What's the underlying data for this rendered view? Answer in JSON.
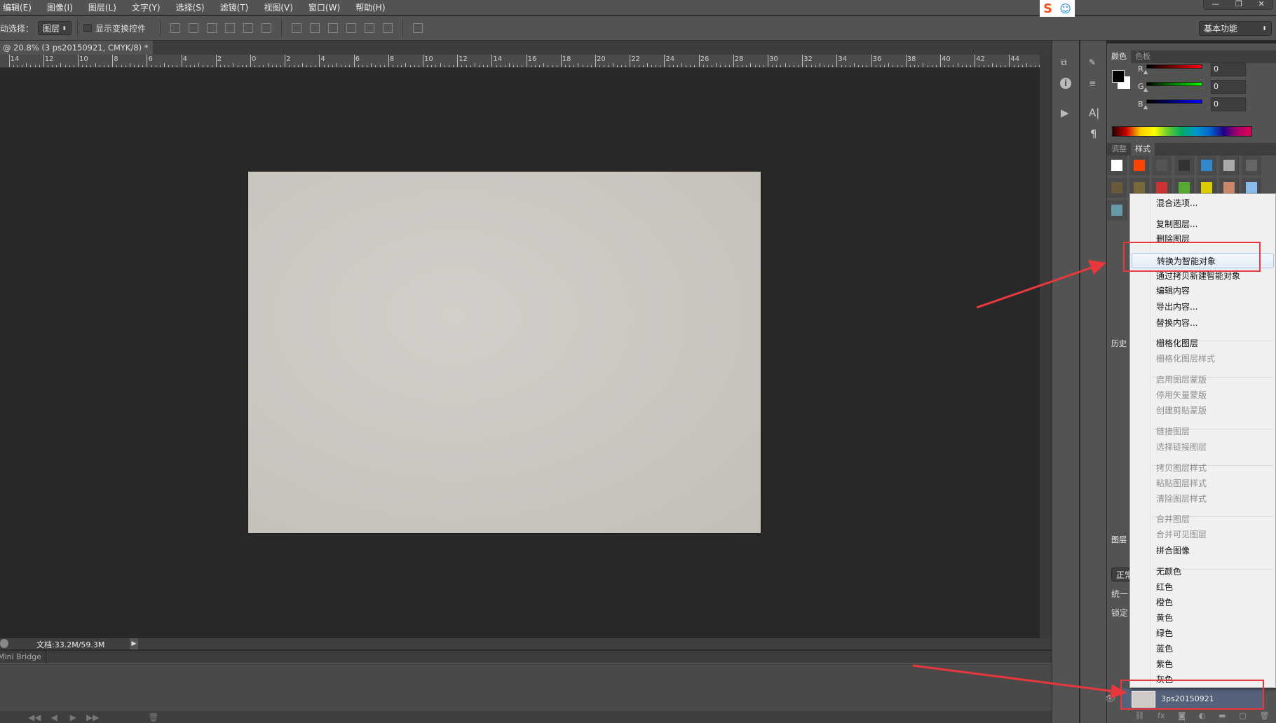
{
  "menu": [
    "编辑(E)",
    "图像(I)",
    "图层(L)",
    "文字(Y)",
    "选择(S)",
    "滤镜(T)",
    "视图(V)",
    "窗口(W)",
    "帮助(H)"
  ],
  "options": {
    "auto_select_label": "动选择：",
    "auto_select_value": "图层",
    "show_transform": "显示变换控件",
    "workspace": "基本功能"
  },
  "document_tab": {
    "title": "@ 20.8% (3 ps20150921, CMYK/8) *",
    "close": "×"
  },
  "ruler_labels": [
    "14",
    "12",
    "10",
    "8",
    "6",
    "4",
    "2",
    "0",
    "2",
    "4",
    "6",
    "8",
    "10",
    "12",
    "14",
    "16",
    "18",
    "20",
    "22",
    "24",
    "26",
    "28",
    "30",
    "32",
    "34",
    "36",
    "38",
    "40",
    "42",
    "44"
  ],
  "status": {
    "doc_size": "文档:33.2M/59.3M"
  },
  "mini_bridge": {
    "tab": "Mini Bridge"
  },
  "color_panel": {
    "tabs": [
      "颜色",
      "色板"
    ],
    "channels": [
      {
        "label": "R",
        "value": "0",
        "color": "#ff0000"
      },
      {
        "label": "G",
        "value": "0",
        "color": "#00ff00"
      },
      {
        "label": "B",
        "value": "0",
        "color": "#0000ff"
      }
    ]
  },
  "styles_panel": {
    "tabs": [
      "调整",
      "样式"
    ]
  },
  "history_panel": {
    "tab": "历史"
  },
  "layers_panel": {
    "tab": "图层",
    "blend": "正常",
    "unify": "统一",
    "lock": "锁定",
    "layer_name": "3ps20150921"
  },
  "context_menu": {
    "items": [
      {
        "label": "混合选项...",
        "enabled": true
      },
      {
        "label": "复制图层...",
        "enabled": true
      },
      {
        "label": "删除图层",
        "enabled": true
      },
      {
        "label": "转换为智能对象",
        "enabled": true,
        "highlighted": true
      },
      {
        "label": "通过拷贝新建智能对象",
        "enabled": true
      },
      {
        "label": "编辑内容",
        "enabled": true
      },
      {
        "label": "导出内容...",
        "enabled": true
      },
      {
        "label": "替换内容...",
        "enabled": true
      },
      {
        "label": "栅格化图层",
        "enabled": true
      },
      {
        "label": "栅格化图层样式",
        "enabled": false
      },
      {
        "label": "启用图层蒙版",
        "enabled": false
      },
      {
        "label": "停用矢量蒙版",
        "enabled": false
      },
      {
        "label": "创建剪贴蒙版",
        "enabled": false
      },
      {
        "label": "链接图层",
        "enabled": false
      },
      {
        "label": "选择链接图层",
        "enabled": false
      },
      {
        "label": "拷贝图层样式",
        "enabled": false
      },
      {
        "label": "粘贴图层样式",
        "enabled": false
      },
      {
        "label": "清除图层样式",
        "enabled": false
      },
      {
        "label": "合并图层",
        "enabled": false
      },
      {
        "label": "合并可见图层",
        "enabled": false
      },
      {
        "label": "拼合图像",
        "enabled": true
      },
      {
        "label": "无颜色",
        "enabled": true
      },
      {
        "label": "红色",
        "enabled": true
      },
      {
        "label": "橙色",
        "enabled": true
      },
      {
        "label": "黄色",
        "enabled": true
      },
      {
        "label": "绿色",
        "enabled": true
      },
      {
        "label": "蓝色",
        "enabled": true
      },
      {
        "label": "紫色",
        "enabled": true
      },
      {
        "label": "灰色",
        "enabled": true
      }
    ]
  },
  "annotation_color": "#e8383d"
}
